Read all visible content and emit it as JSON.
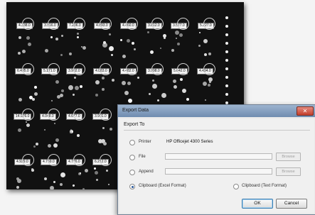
{
  "array_image": {
    "top_labels": [
      "4.338.0",
      "3.916.0",
      "7.206.0",
      "4.093.0",
      "4.460.0",
      "3.812.0",
      "3.577.0",
      "5.227.0"
    ],
    "row2_labels": [
      "6.495.0",
      "5.171.0",
      "3.902.0",
      "4.083.0",
      "4.482.0",
      "3.998.0",
      "5.642.0",
      "4.494.0"
    ],
    "row3_labels": [
      "14.976.0",
      "4.048.0",
      "4.677.0",
      "3.901.0"
    ],
    "row4_labels": [
      "4.929.0",
      "4.769.0",
      "4.776.0",
      "6.212.0"
    ]
  },
  "dialog": {
    "title": "Export Data",
    "close_label": "✕",
    "section_label": "Export To",
    "options": {
      "printer_label": "Printer",
      "printer_value": "HP Officejet 4300 Series",
      "file_label": "File",
      "file_value": "",
      "append_label": "Append",
      "append_value": "",
      "clipboard_excel_label": "Clipboard (Excel Format)",
      "clipboard_text_label": "Clipboard (Text Format)"
    },
    "browse_label": "Browse",
    "ok_label": "OK",
    "cancel_label": "Cancel",
    "selected_option": "clipboard_excel"
  }
}
